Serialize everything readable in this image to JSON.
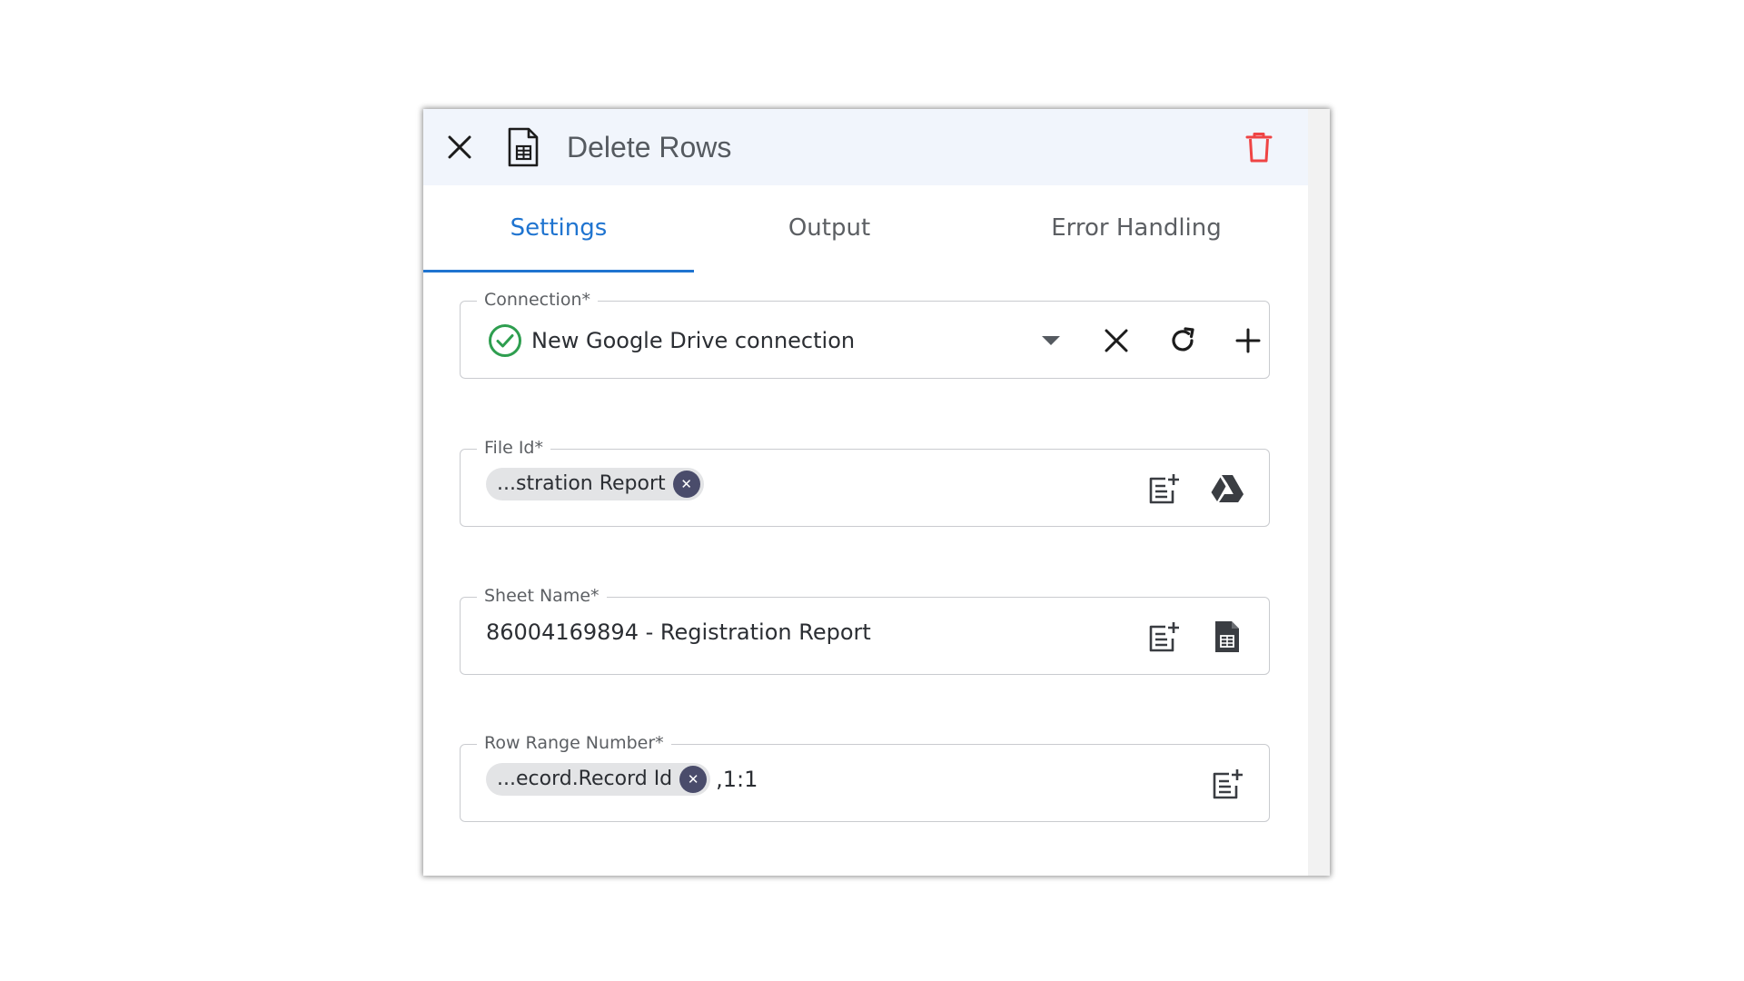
{
  "header": {
    "title": "Delete Rows",
    "close_icon": "close-icon",
    "sheet_icon": "google-sheets-file-icon",
    "delete_icon": "trash-icon",
    "delete_color": "#ef4444"
  },
  "tabs": [
    {
      "label": "Settings",
      "active": true
    },
    {
      "label": "Output",
      "active": false
    },
    {
      "label": "Error Handling",
      "active": false
    }
  ],
  "accent_color": "#1f74d0",
  "fields": {
    "connection": {
      "label": "Connection*",
      "value": "New Google Drive connection",
      "status_icon": "check-circle-icon",
      "status_color": "#2e9e4f",
      "actions": [
        "dropdown-arrow-icon",
        "clear-icon",
        "refresh-icon",
        "add-icon"
      ]
    },
    "file_id": {
      "label": "File Id*",
      "chip": "...stration Report",
      "actions": [
        "insert-variable-icon",
        "google-drive-icon"
      ]
    },
    "sheet_name": {
      "label": "Sheet Name*",
      "value": "86004169894 - Registration Report",
      "actions": [
        "insert-variable-icon",
        "sheet-file-icon"
      ]
    },
    "row_range": {
      "label": "Row Range Number*",
      "chip": "...ecord.Record Id",
      "suffix": ",1:1",
      "actions": [
        "insert-variable-icon"
      ]
    }
  }
}
